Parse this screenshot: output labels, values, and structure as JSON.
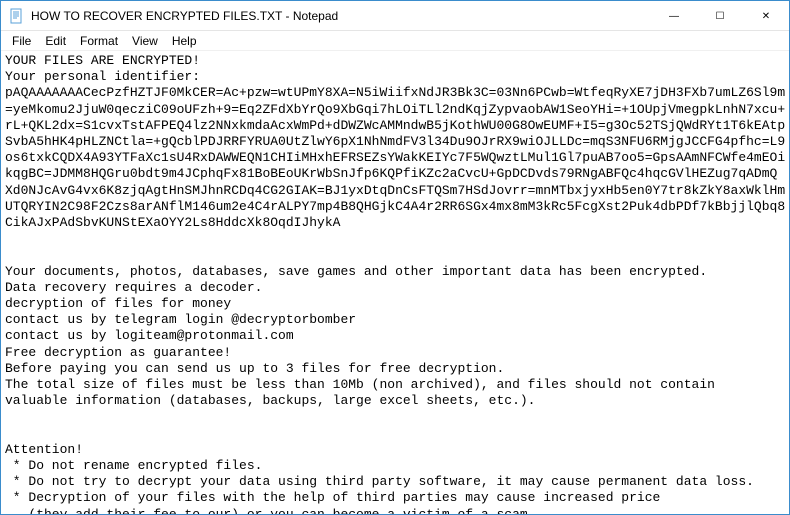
{
  "window": {
    "title": "HOW TO RECOVER ENCRYPTED FILES.TXT - Notepad"
  },
  "menu": {
    "file": "File",
    "edit": "Edit",
    "format": "Format",
    "view": "View",
    "help": "Help"
  },
  "controls": {
    "minimize": "—",
    "maximize": "☐",
    "close": "✕"
  },
  "body": {
    "header": "YOUR FILES ARE ENCRYPTED!",
    "pid_label": "Your personal identifier:",
    "pid_block": "pAQAAAAAAACecPzfHZTJF0MkCER=Ac+pzw=wtUPmY8XA=N5iWiifxNdJR3Bk3C=03Nn6PCwb=WtfeqRyXE7jDH3FXb7umLZ6Sl9m\n=yeMkomu2JjuW0qecziC09oUFzh+9=Eq2ZFdXbYrQo9XbGqi7hLOiTLl2ndKqjZypvaobAW1SeoYHi=+1OUpjVmegpkLnhN7xcu+\nrL+QKL2dx=S1cvxTstAFPEQ4lz2NNxkmdaAcxWmPd+dDWZWcAMMndwB5jKothWU00G8OwEUMF+I5=g3Oc52TSjQWdRYt1T6kEAtp\nSvbA5hHK4pHLZNCtla=+gQcblPDJRRFYRUA0UtZlwY6pX1NhNmdFV3l34Du9OJrRX9wiOJLLDc=mqS3NFU6RMjgJCCFG4pfhc=L9\nos6txkCQDX4A93YTFaXc1sU4RxDAWWEQN1CHIiMHxhEFRSEZsYWakKEIYc7F5WQwztLMul1Gl7puAB7oo5=GpsAAmNFCWfe4mEOi\nkqgBC=JDMM8HQGru0bdt9m4JCphqFx81BoBEoUKrWbSnJfp6KQPfiKZc2aCvcU+GpDCDvds79RNgABFQc4hqcGVlHEZug7qADmQ\nXd0NJcAvG4vx6K8zjqAgtHnSMJhnRCDq4CG2GIAK=BJ1yxDtqDnCsFTQSm7HSdJovrr=mnMTbxjyxHb5en0Y7tr8kZkY8axWklHm\nUTQRYIN2C98F2Czs8arANflM146um2e4C4rALPY7mp4B8QHGjkC4A4r2RR6SGx4mx8mM3kRc5FcgXst2Puk4dbPDf7kBbjjlQbq8\nCikAJxPAdSbvKUNStEXaOYY2Ls8HddcXk8OqdIJhykA",
    "section2": "Your documents, photos, databases, save games and other important data has been encrypted.\nData recovery requires a decoder.\ndecryption of files for money\ncontact us by telegram login @decryptorbomber\ncontact us by logiteam@protonmail.com\nFree decryption as guarantee!\nBefore paying you can send us up to 3 files for free decryption.\nThe total size of files must be less than 10Mb (non archived), and files should not contain\nvaluable information (databases, backups, large excel sheets, etc.).",
    "attention_header": "Attention!",
    "bullet1": " * Do not rename encrypted files.",
    "bullet2": " * Do not try to decrypt your data using third party software, it may cause permanent data loss.",
    "bullet3": " * Decryption of your files with the help of third parties may cause increased price\n   (they add their fee to our) or you can become a victim of a scam."
  }
}
